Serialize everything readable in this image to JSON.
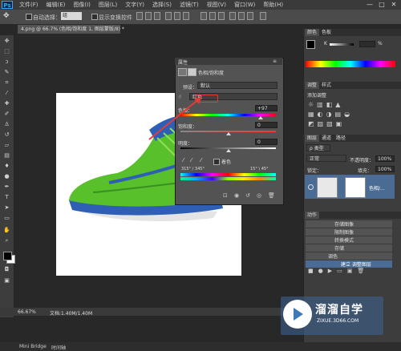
{
  "app": {
    "logo": "Ps",
    "menus": [
      "文件(F)",
      "编辑(E)",
      "图像(I)",
      "图层(L)",
      "文字(Y)",
      "选择(S)",
      "滤镜(T)",
      "视图(V)",
      "窗口(W)",
      "帮助(H)"
    ],
    "window_controls": [
      "—",
      "□",
      "✕"
    ]
  },
  "options_bar": {
    "auto_select_label": "自动选择：",
    "auto_select_value": "组",
    "show_transform_label": "显示变换控件"
  },
  "document": {
    "tab_label": "4.png @ 66.7% (色相/饱和度 1, 图层蒙版/8) *",
    "zoom": "66.67%",
    "doc_size": "文档:1.40M/1.40M"
  },
  "properties": {
    "panel_title": "属性",
    "adjustment_name": "色相/饱和度",
    "preset_label": "预设：",
    "preset_value": "默认",
    "channel_value": "红色",
    "hue_label": "色相：",
    "hue_value": "+97",
    "saturation_label": "饱和度：",
    "saturation_value": "0",
    "lightness_label": "明度：",
    "lightness_value": "0",
    "colorize_label": "着色",
    "range_left": "315° / 345°",
    "range_right": "15° \\ 45°"
  },
  "right_panels": {
    "color_tabs": [
      "颜色",
      "色板"
    ],
    "color_k": "K",
    "color_pct": "%",
    "adjust_tabs": [
      "调整",
      "样式"
    ],
    "adjust_add_label": "添加调整",
    "layers_tabs": [
      "图层",
      "通道",
      "路径"
    ],
    "kind_label": "ρ 类型",
    "blend_mode": "正常",
    "opacity_label": "不透明度：",
    "opacity_value": "100%",
    "lock_label": "锁定：",
    "fill_label": "填充：",
    "fill_value": "100%",
    "layer_name": "色相/...",
    "actions_tab": "动作",
    "actions": [
      "转换模式",
      "存储",
      "调色",
      "建立 调整图层"
    ],
    "actions_partial": [
      "存储图像",
      "限制图像"
    ]
  },
  "status": {
    "mini_bridge": "Mini Bridge",
    "timeline": "时间轴"
  },
  "watermark": {
    "brand": "溜溜自学",
    "url": "ZIXUE.3D66.COM"
  },
  "colors": {
    "accent_red": "#e23b3b",
    "shoe_green": "#5cc72e",
    "shoe_blue": "#2c5fb8"
  }
}
